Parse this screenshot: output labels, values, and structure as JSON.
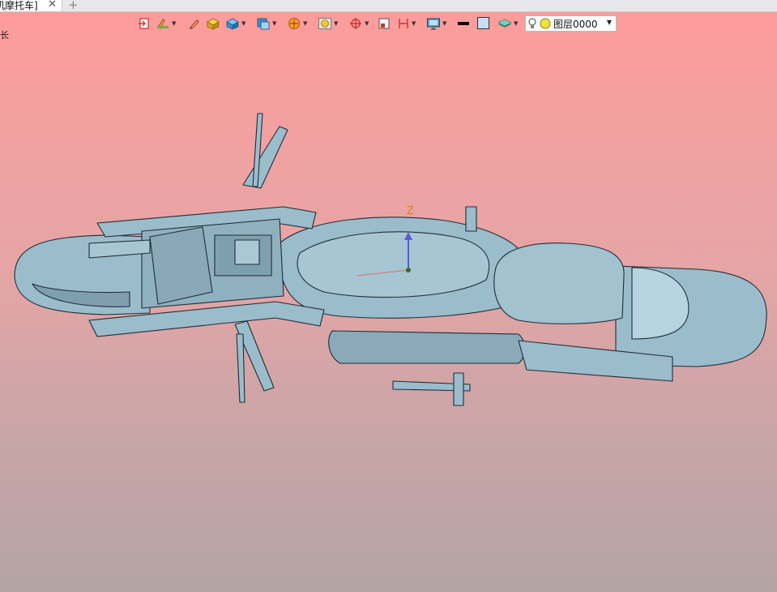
{
  "tab": {
    "title": "机摩托车]",
    "close": "✕",
    "add": "+"
  },
  "left_glyph": "长",
  "toolbar": {
    "items": [
      {
        "name": "exit-sketch-icon"
      },
      {
        "name": "sketch-tools-icon"
      },
      {
        "name": "pencil-icon"
      },
      {
        "name": "solid-box-icon"
      },
      {
        "name": "shaded-cube-icon"
      },
      {
        "name": "view-cube-icon"
      },
      {
        "name": "section-view-icon"
      },
      {
        "name": "display-mode-icon"
      },
      {
        "name": "orient-axis-icon"
      },
      {
        "name": "window-frame-icon"
      },
      {
        "name": "dimension-icon"
      },
      {
        "name": "monitor-icon"
      },
      {
        "name": "line-style-icon"
      },
      {
        "name": "color-swatch-icon"
      },
      {
        "name": "layers-icon"
      }
    ]
  },
  "layer": {
    "value": "图层0000"
  },
  "axis": {
    "z_label": "Z"
  },
  "colors": {
    "model": "#9bbccb",
    "model_dark": "#2a3a44",
    "bg_top": "#ff9c9b",
    "bg_bottom": "#b4a4a5"
  }
}
